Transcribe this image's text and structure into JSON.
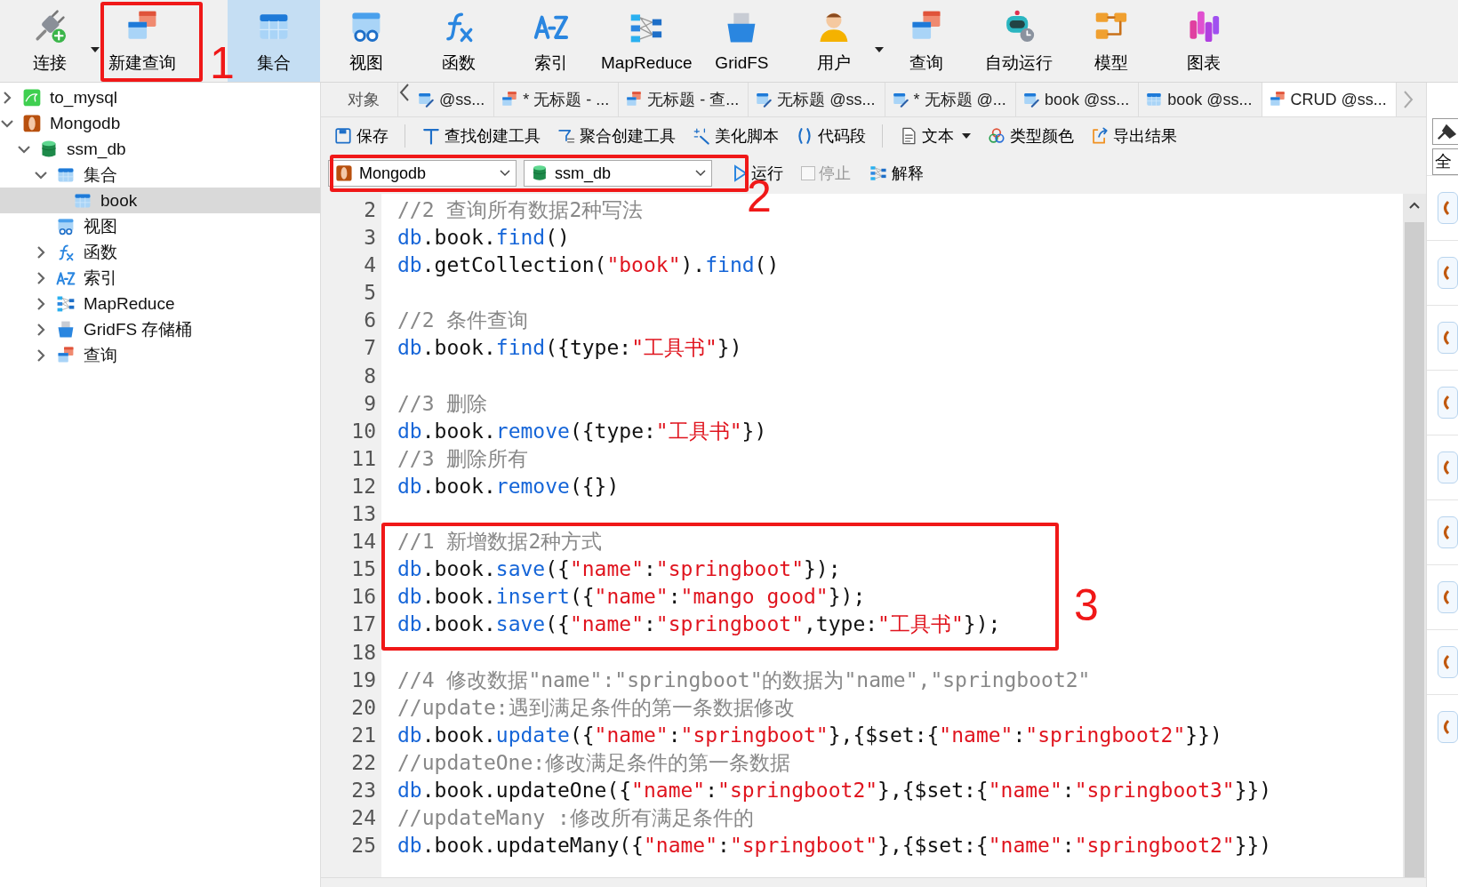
{
  "toolbar": [
    {
      "kind": "plug",
      "label": "连接",
      "selected": false,
      "has_menu": true
    },
    {
      "kind": "query",
      "label": "新建查询",
      "selected": false,
      "has_menu": false
    },
    {
      "kind": "collection",
      "label": "集合",
      "selected": true,
      "has_menu": false
    },
    {
      "kind": "view",
      "label": "视图",
      "selected": false,
      "has_menu": false
    },
    {
      "kind": "function",
      "label": "函数",
      "selected": false,
      "has_menu": false
    },
    {
      "kind": "az",
      "label": "索引",
      "selected": false,
      "has_menu": false
    },
    {
      "kind": "mapreduce",
      "label": "MapReduce",
      "selected": false,
      "has_menu": false
    },
    {
      "kind": "gridfs",
      "label": "GridFS",
      "selected": false,
      "has_menu": false
    },
    {
      "kind": "user",
      "label": "用户",
      "selected": false,
      "has_menu": true
    },
    {
      "kind": "query",
      "label": "查询",
      "selected": false,
      "has_menu": false
    },
    {
      "kind": "robot",
      "label": "自动运行",
      "selected": false,
      "has_menu": false
    },
    {
      "kind": "model",
      "label": "模型",
      "selected": false,
      "has_menu": false
    },
    {
      "kind": "chart",
      "label": "图表",
      "selected": false,
      "has_menu": false
    }
  ],
  "sidebar": {
    "tree": [
      {
        "kind": "mysql",
        "label": "to_mysql",
        "expanded": false,
        "selected": false
      },
      {
        "kind": "mongo",
        "label": "Mongodb",
        "expanded": true,
        "selected": false,
        "children": [
          {
            "kind": "db",
            "label": "ssm_db",
            "expanded": true,
            "selected": false,
            "children": [
              {
                "kind": "collection",
                "label": "集合",
                "expanded": true,
                "selected": false,
                "children": [
                  {
                    "kind": "collection",
                    "label": "book",
                    "selected": true
                  }
                ]
              },
              {
                "kind": "view",
                "label": "视图",
                "selected": false
              },
              {
                "kind": "function",
                "label": "函数",
                "expanded": false,
                "selected": false
              },
              {
                "kind": "az",
                "label": "索引",
                "expanded": false,
                "selected": false
              },
              {
                "kind": "mapreduce",
                "label": "MapReduce",
                "expanded": false,
                "selected": false
              },
              {
                "kind": "gridfs",
                "label": "GridFS 存储桶",
                "expanded": false,
                "selected": false
              },
              {
                "kind": "query",
                "label": "查询",
                "expanded": false,
                "selected": false
              }
            ]
          }
        ]
      }
    ]
  },
  "tabs": [
    {
      "label": "对象",
      "selected": false
    },
    {
      "kind": "collection-edit",
      "label": "@ss...",
      "selected": false
    },
    {
      "kind": "query",
      "label": "* 无标题 - ...",
      "selected": false
    },
    {
      "kind": "query",
      "label": "无标题 - 查...",
      "selected": false
    },
    {
      "kind": "collection-edit",
      "label": "无标题 @ss...",
      "selected": false
    },
    {
      "kind": "collection-edit",
      "label": "* 无标题 @...",
      "selected": false
    },
    {
      "kind": "collection-edit",
      "label": "book @ss...",
      "selected": false
    },
    {
      "kind": "collection",
      "label": "book @ss...",
      "selected": false
    },
    {
      "kind": "query",
      "label": "CRUD @ss...",
      "selected": true
    }
  ],
  "editor_toolbar": [
    {
      "kind": "save",
      "label": "保存"
    },
    {
      "kind": "find",
      "label": "查找创建工具"
    },
    {
      "kind": "agg",
      "label": "聚合创建工具"
    },
    {
      "kind": "magic",
      "label": "美化脚本"
    },
    {
      "kind": "brackets",
      "label": "代码段"
    },
    {
      "kind": "text",
      "label": "文本",
      "has_menu": true
    },
    {
      "kind": "colors",
      "label": "类型颜色"
    },
    {
      "kind": "export",
      "label": "导出结果"
    }
  ],
  "run_bar": {
    "connection": "Mongodb",
    "database": "ssm_db",
    "run": "运行",
    "stop": {
      "label": "停止",
      "disabled": true
    },
    "explain": "解释"
  },
  "code": [
    {
      "n": "2",
      "tokens": [
        {
          "kind": "comment",
          "text": "//2 查询所有数据2种写法"
        }
      ]
    },
    {
      "n": "3",
      "tokens": [
        {
          "kind": "kw",
          "text": "db"
        },
        {
          "kind": "plain",
          "text": ".book."
        },
        {
          "kind": "kw",
          "text": "find"
        },
        {
          "kind": "plain",
          "text": "()"
        }
      ]
    },
    {
      "n": "4",
      "tokens": [
        {
          "kind": "kw",
          "text": "db"
        },
        {
          "kind": "plain",
          "text": ".getCollection("
        },
        {
          "kind": "str",
          "text": "\"book\""
        },
        {
          "kind": "plain",
          "text": ")."
        },
        {
          "kind": "kw",
          "text": "find"
        },
        {
          "kind": "plain",
          "text": "()"
        }
      ]
    },
    {
      "n": "5"
    },
    {
      "n": "6",
      "tokens": [
        {
          "kind": "comment",
          "text": "//2 条件查询"
        }
      ]
    },
    {
      "n": "7",
      "tokens": [
        {
          "kind": "kw",
          "text": "db"
        },
        {
          "kind": "plain",
          "text": ".book."
        },
        {
          "kind": "kw",
          "text": "find"
        },
        {
          "kind": "plain",
          "text": "({type:"
        },
        {
          "kind": "str",
          "text": "\"工具书\""
        },
        {
          "kind": "plain",
          "text": "})"
        }
      ]
    },
    {
      "n": "8"
    },
    {
      "n": "9",
      "tokens": [
        {
          "kind": "comment",
          "text": "//3 删除"
        }
      ]
    },
    {
      "n": "10",
      "tokens": [
        {
          "kind": "kw",
          "text": "db"
        },
        {
          "kind": "plain",
          "text": ".book."
        },
        {
          "kind": "kw",
          "text": "remove"
        },
        {
          "kind": "plain",
          "text": "({type:"
        },
        {
          "kind": "str",
          "text": "\"工具书\""
        },
        {
          "kind": "plain",
          "text": "})"
        }
      ]
    },
    {
      "n": "11",
      "tokens": [
        {
          "kind": "comment",
          "text": "//3 删除所有"
        }
      ]
    },
    {
      "n": "12",
      "tokens": [
        {
          "kind": "kw",
          "text": "db"
        },
        {
          "kind": "plain",
          "text": ".book."
        },
        {
          "kind": "kw",
          "text": "remove"
        },
        {
          "kind": "plain",
          "text": "({})"
        }
      ]
    },
    {
      "n": "13"
    },
    {
      "n": "14",
      "tokens": [
        {
          "kind": "comment",
          "text": "//1 新增数据2种方式"
        }
      ]
    },
    {
      "n": "15",
      "tokens": [
        {
          "kind": "kw",
          "text": "db"
        },
        {
          "kind": "plain",
          "text": ".book."
        },
        {
          "kind": "kw",
          "text": "save"
        },
        {
          "kind": "plain",
          "text": "({"
        },
        {
          "kind": "str",
          "text": "\"name\""
        },
        {
          "kind": "plain",
          "text": ":"
        },
        {
          "kind": "str",
          "text": "\"springboot\""
        },
        {
          "kind": "plain",
          "text": "});"
        }
      ]
    },
    {
      "n": "16",
      "tokens": [
        {
          "kind": "kw",
          "text": "db"
        },
        {
          "kind": "plain",
          "text": ".book."
        },
        {
          "kind": "kw",
          "text": "insert"
        },
        {
          "kind": "plain",
          "text": "({"
        },
        {
          "kind": "str",
          "text": "\"name\""
        },
        {
          "kind": "plain",
          "text": ":"
        },
        {
          "kind": "str",
          "text": "\"mango good\""
        },
        {
          "kind": "plain",
          "text": "});"
        }
      ]
    },
    {
      "n": "17",
      "tokens": [
        {
          "kind": "kw",
          "text": "db"
        },
        {
          "kind": "plain",
          "text": ".book."
        },
        {
          "kind": "kw",
          "text": "save"
        },
        {
          "kind": "plain",
          "text": "({"
        },
        {
          "kind": "str",
          "text": "\"name\""
        },
        {
          "kind": "plain",
          "text": ":"
        },
        {
          "kind": "str",
          "text": "\"springboot\""
        },
        {
          "kind": "plain",
          "text": ",type:"
        },
        {
          "kind": "str",
          "text": "\"工具书\""
        },
        {
          "kind": "plain",
          "text": "});"
        }
      ]
    },
    {
      "n": "18"
    },
    {
      "n": "19",
      "tokens": [
        {
          "kind": "comment",
          "text": "//4 修改数据\"name\":\"springboot\"的数据为\"name\",\"springboot2\""
        }
      ]
    },
    {
      "n": "20",
      "tokens": [
        {
          "kind": "comment",
          "text": "//update:遇到满足条件的第一条数据修改"
        }
      ]
    },
    {
      "n": "21",
      "tokens": [
        {
          "kind": "kw",
          "text": "db"
        },
        {
          "kind": "plain",
          "text": ".book."
        },
        {
          "kind": "kw",
          "text": "update"
        },
        {
          "kind": "plain",
          "text": "({"
        },
        {
          "kind": "str",
          "text": "\"name\""
        },
        {
          "kind": "plain",
          "text": ":"
        },
        {
          "kind": "str",
          "text": "\"springboot\""
        },
        {
          "kind": "plain",
          "text": "},{$set:{"
        },
        {
          "kind": "str",
          "text": "\"name\""
        },
        {
          "kind": "plain",
          "text": ":"
        },
        {
          "kind": "str",
          "text": "\"springboot2\""
        },
        {
          "kind": "plain",
          "text": "}})"
        }
      ]
    },
    {
      "n": "22",
      "tokens": [
        {
          "kind": "comment",
          "text": "//updateOne:修改满足条件的第一条数据"
        }
      ]
    },
    {
      "n": "23",
      "tokens": [
        {
          "kind": "kw",
          "text": "db"
        },
        {
          "kind": "plain",
          "text": ".book.updateOne({"
        },
        {
          "kind": "str",
          "text": "\"name\""
        },
        {
          "kind": "plain",
          "text": ":"
        },
        {
          "kind": "str",
          "text": "\"springboot2\""
        },
        {
          "kind": "plain",
          "text": "},{$set:{"
        },
        {
          "kind": "str",
          "text": "\"name\""
        },
        {
          "kind": "plain",
          "text": ":"
        },
        {
          "kind": "str",
          "text": "\"springboot3\""
        },
        {
          "kind": "plain",
          "text": "}})"
        }
      ]
    },
    {
      "n": "24",
      "tokens": [
        {
          "kind": "comment",
          "text": "//updateMany :修改所有满足条件的"
        }
      ]
    },
    {
      "n": "25",
      "tokens": [
        {
          "kind": "kw",
          "text": "db"
        },
        {
          "kind": "plain",
          "text": ".book.updateMany({"
        },
        {
          "kind": "str",
          "text": "\"name\""
        },
        {
          "kind": "plain",
          "text": ":"
        },
        {
          "kind": "str",
          "text": "\"springboot\""
        },
        {
          "kind": "plain",
          "text": "},{$set:{"
        },
        {
          "kind": "str",
          "text": "\"name\""
        },
        {
          "kind": "plain",
          "text": ":"
        },
        {
          "kind": "str",
          "text": "\"springboot2\""
        },
        {
          "kind": "plain",
          "text": "}})"
        }
      ]
    }
  ],
  "right_panel": {
    "filter": "全",
    "items": [
      {
        "kind": "mongo"
      },
      {
        "kind": "mongo"
      },
      {
        "kind": "mongo"
      },
      {
        "kind": "mongo"
      },
      {
        "kind": "mongo"
      },
      {
        "kind": "mongo"
      },
      {
        "kind": "mongo"
      },
      {
        "kind": "mongo"
      },
      {
        "kind": "mongo"
      }
    ]
  },
  "annotations": [
    {
      "label": "1"
    },
    {
      "label": "2"
    },
    {
      "label": "3"
    }
  ]
}
